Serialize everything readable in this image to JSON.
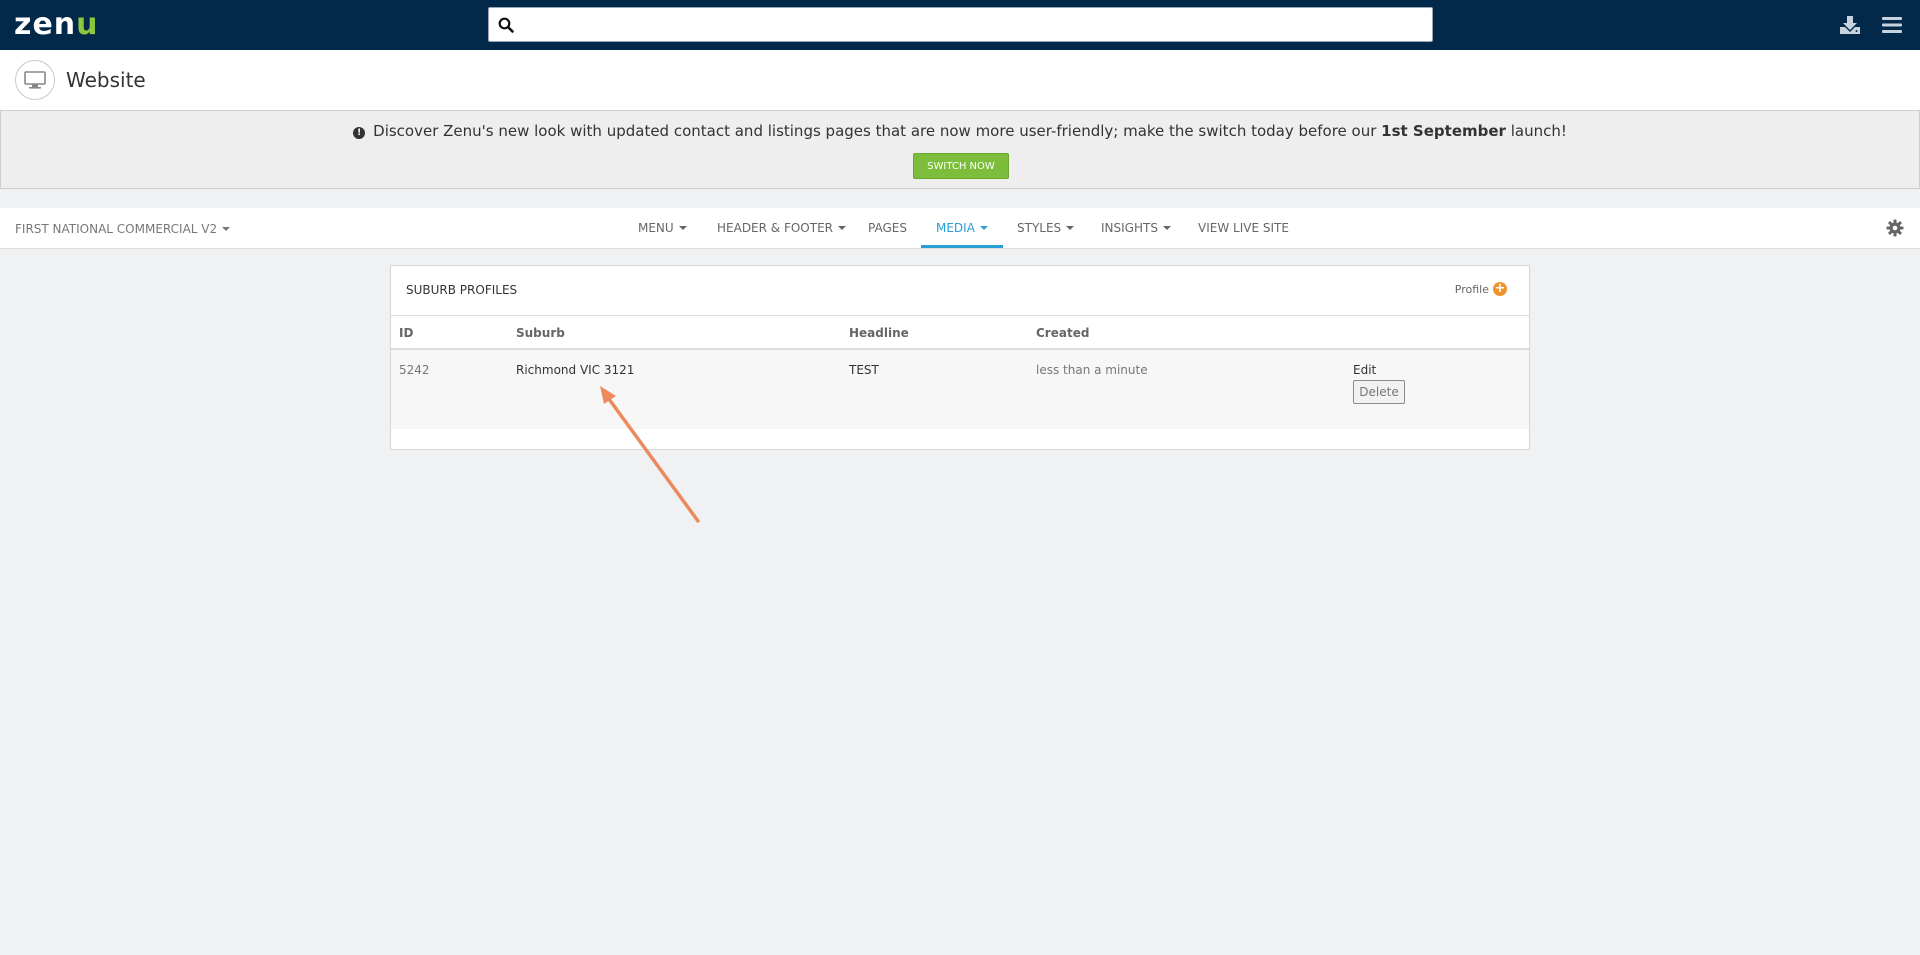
{
  "brand": {
    "logo_white": "zen",
    "logo_green": "u"
  },
  "search": {
    "placeholder": "",
    "value": ""
  },
  "topbar_icons": [
    "download-icon",
    "hamburger-menu-icon"
  ],
  "page": {
    "title": "Website",
    "icon": "monitor-icon"
  },
  "announcement": {
    "text_before": "Discover Zenu's new look with updated contact and listings pages that are now more user-friendly; make the switch today before our ",
    "bold": "1st September",
    "text_after": " launch!",
    "button": "Switch Now"
  },
  "navbar": {
    "site_selector": "First National Commercial V2",
    "items": [
      {
        "label": "Menu",
        "dropdown": true
      },
      {
        "label": "Header & Footer",
        "dropdown": true
      },
      {
        "label": "Pages",
        "dropdown": false
      },
      {
        "label": "Media",
        "dropdown": true,
        "active": true
      },
      {
        "label": "Styles",
        "dropdown": true
      },
      {
        "label": "Insights",
        "dropdown": true
      },
      {
        "label": "View Live Site",
        "dropdown": false
      }
    ]
  },
  "panel": {
    "title": "Suburb Profiles",
    "add_label": "Profile",
    "columns": [
      "ID",
      "Suburb",
      "Headline",
      "Created"
    ],
    "rows": [
      {
        "id": "5242",
        "suburb": "Richmond VIC 3121",
        "headline": "TEST",
        "created": "less than a minute",
        "edit": "Edit",
        "delete": "Delete"
      }
    ]
  },
  "colors": {
    "topbar": "#03294a",
    "brand_green": "#8dc63f",
    "switch_button": "#7cbd3b",
    "active_nav": "#2a9fd6",
    "add_icon": "#f0932b",
    "annotation_arrow": "#ec8a5e"
  }
}
